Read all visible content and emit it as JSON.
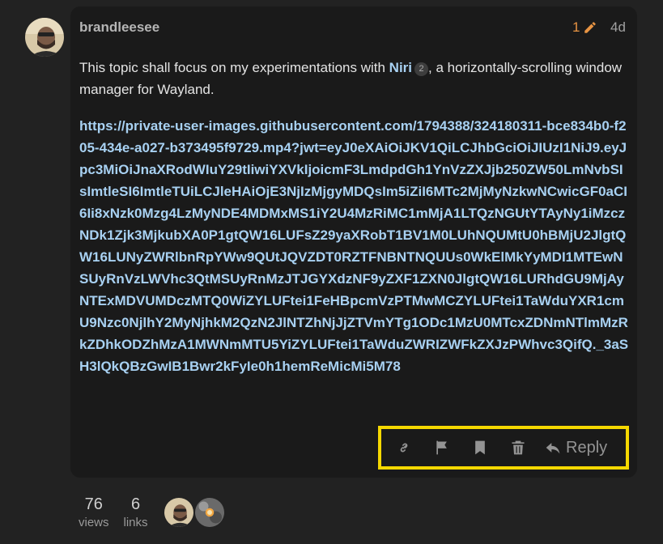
{
  "post": {
    "author": "brandleesee",
    "edit_count": "1",
    "edit_icon": "pencil-icon",
    "age": "4d",
    "intro_prefix": "This topic shall focus on my experimentations with ",
    "intro_link": "Niri",
    "intro_link_badge": "2",
    "intro_suffix": ", a horizontally-scrolling window manager for Wayland.",
    "video_url": "https://private-user-images.githubusercontent.com/1794388/324180311-bce834b0-f205-434e-a027-b373495f9729.mp4?jwt=eyJ0eXAiOiJKV1QiLCJhbGciOiJIUzI1NiJ9.eyJpc3MiOiJnaXRodWIuY29tIiwiYXVkIjoicmF3LmdpdGh1YnVzZXJjb250ZW50LmNvbSIsImtleSI6ImtleTUiLCJleHAiOjE3NjIzMjgyMDQsIm5iZiI6MTc2MjMyNzkwNCwicGF0aCI6Ii8xNzk0Mzg4LzMyNDE4MDMxMS1iY2U4MzRiMC1mMjA1LTQzNGUtYTAyNy1iMzczNDk1Zjk3MjkubXA0P1gtQW16LUFsZ29yaXRobT1BV1M0LUhNQUMtU0hBMjU2JlgtQW16LUNyZWRlbnRpYWw9QUtJQVZDT0RZTFNBNTNQUUs0WkElMkYyMDI1MTEwNSUyRnVzLWVhc3QtMSUyRnMzJTJGYXdzNF9yZXF1ZXN0JlgtQW16LURhdGU9MjAyNTExMDVUMDczMTQ0WiZYLUFtei1FeHBpcmVzPTMwMCZYLUFtei1TaWduYXR1cmU9Nzc0NjlhY2MyNjhkM2QzN2JlNTZhNjJjZTVmYTg1ODc1MzU0MTcxZDNmNTlmMzRkZDhkODZhMzA1MWNmMTU5YiZYLUFtei1TaWduZWRIZWFkZXJzPWhvc3QifQ._3aSH3lQkQBzGwIB1Bwr2kFyIe0h1hemReMicMi5M78"
  },
  "actions": {
    "copy_link_icon": "link-icon",
    "flag_icon": "flag-icon",
    "bookmark_icon": "bookmark-icon",
    "delete_icon": "trash-icon",
    "reply_icon": "reply-icon",
    "reply_label": "Reply",
    "highlight_color": "#f5d800"
  },
  "topic_stats": {
    "views_count": "76",
    "views_label": "views",
    "links_count": "6",
    "links_label": "links"
  },
  "colors": {
    "background": "#222222",
    "card": "#1a1a1a",
    "link": "#a8d1f2",
    "edit_accent": "#e89443"
  }
}
